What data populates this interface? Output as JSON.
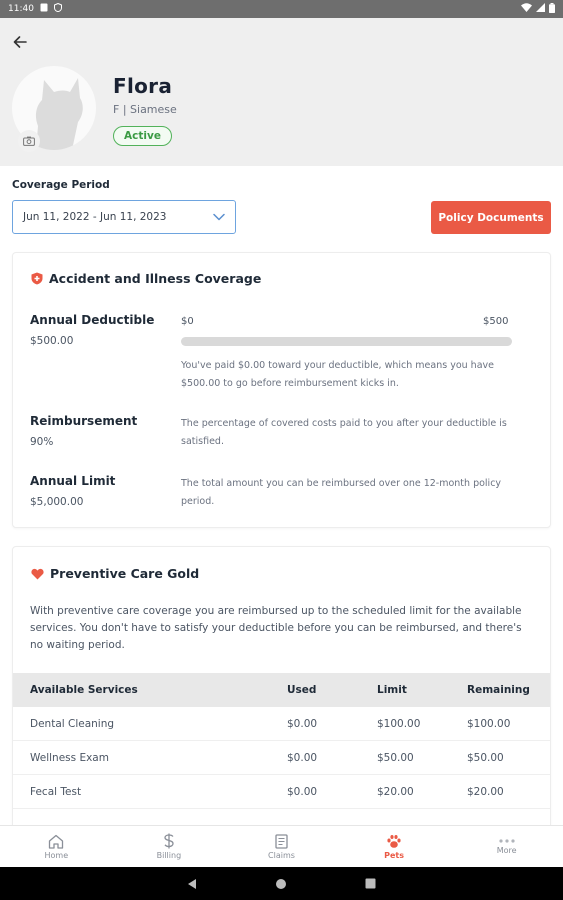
{
  "status_bar": {
    "time": "11:40"
  },
  "pet": {
    "name": "Flora",
    "meta": "F | Siamese",
    "status": "Active"
  },
  "coverage": {
    "label": "Coverage Period",
    "selected": "Jun 11, 2022 - Jun 11, 2023",
    "policy_button": "Policy Documents"
  },
  "accident": {
    "title": "Accident and Illness Coverage",
    "deductible": {
      "label": "Annual Deductible",
      "value": "$500.00",
      "bar_min": "$0",
      "bar_max": "$500",
      "paid_fraction": 0,
      "desc": "You've paid $0.00 toward your deductible, which means you have $500.00 to go before reimbursement kicks in."
    },
    "reimbursement": {
      "label": "Reimbursement",
      "value": "90%",
      "desc": "The percentage of covered costs paid to you after your deductible is satisfied."
    },
    "limit": {
      "label": "Annual Limit",
      "value": "$5,000.00",
      "desc": "The total amount you can be reimbursed over one 12-month policy period."
    }
  },
  "preventive": {
    "title": "Preventive Care Gold",
    "intro": "With preventive care coverage you are reimbursed up to the scheduled limit for the available services. You don't have to satisfy your deductible before you can be reimbursed, and there's no waiting period.",
    "headers": [
      "Available Services",
      "Used",
      "Limit",
      "Remaining"
    ],
    "rows": [
      [
        "Dental Cleaning",
        "$0.00",
        "$100.00",
        "$100.00"
      ],
      [
        "Wellness Exam",
        "$0.00",
        "$50.00",
        "$50.00"
      ],
      [
        "Fecal Test",
        "$0.00",
        "$20.00",
        "$20.00"
      ]
    ]
  },
  "nav": [
    {
      "label": "Home",
      "icon": "home-icon"
    },
    {
      "label": "Billing",
      "icon": "dollar-icon"
    },
    {
      "label": "Claims",
      "icon": "document-icon"
    },
    {
      "label": "Pets",
      "icon": "paw-icon"
    },
    {
      "label": "More",
      "icon": "more-icon"
    }
  ],
  "colors": {
    "accent": "#ea5a45",
    "active_green": "#52b25a",
    "select_border": "#6ea4df"
  }
}
